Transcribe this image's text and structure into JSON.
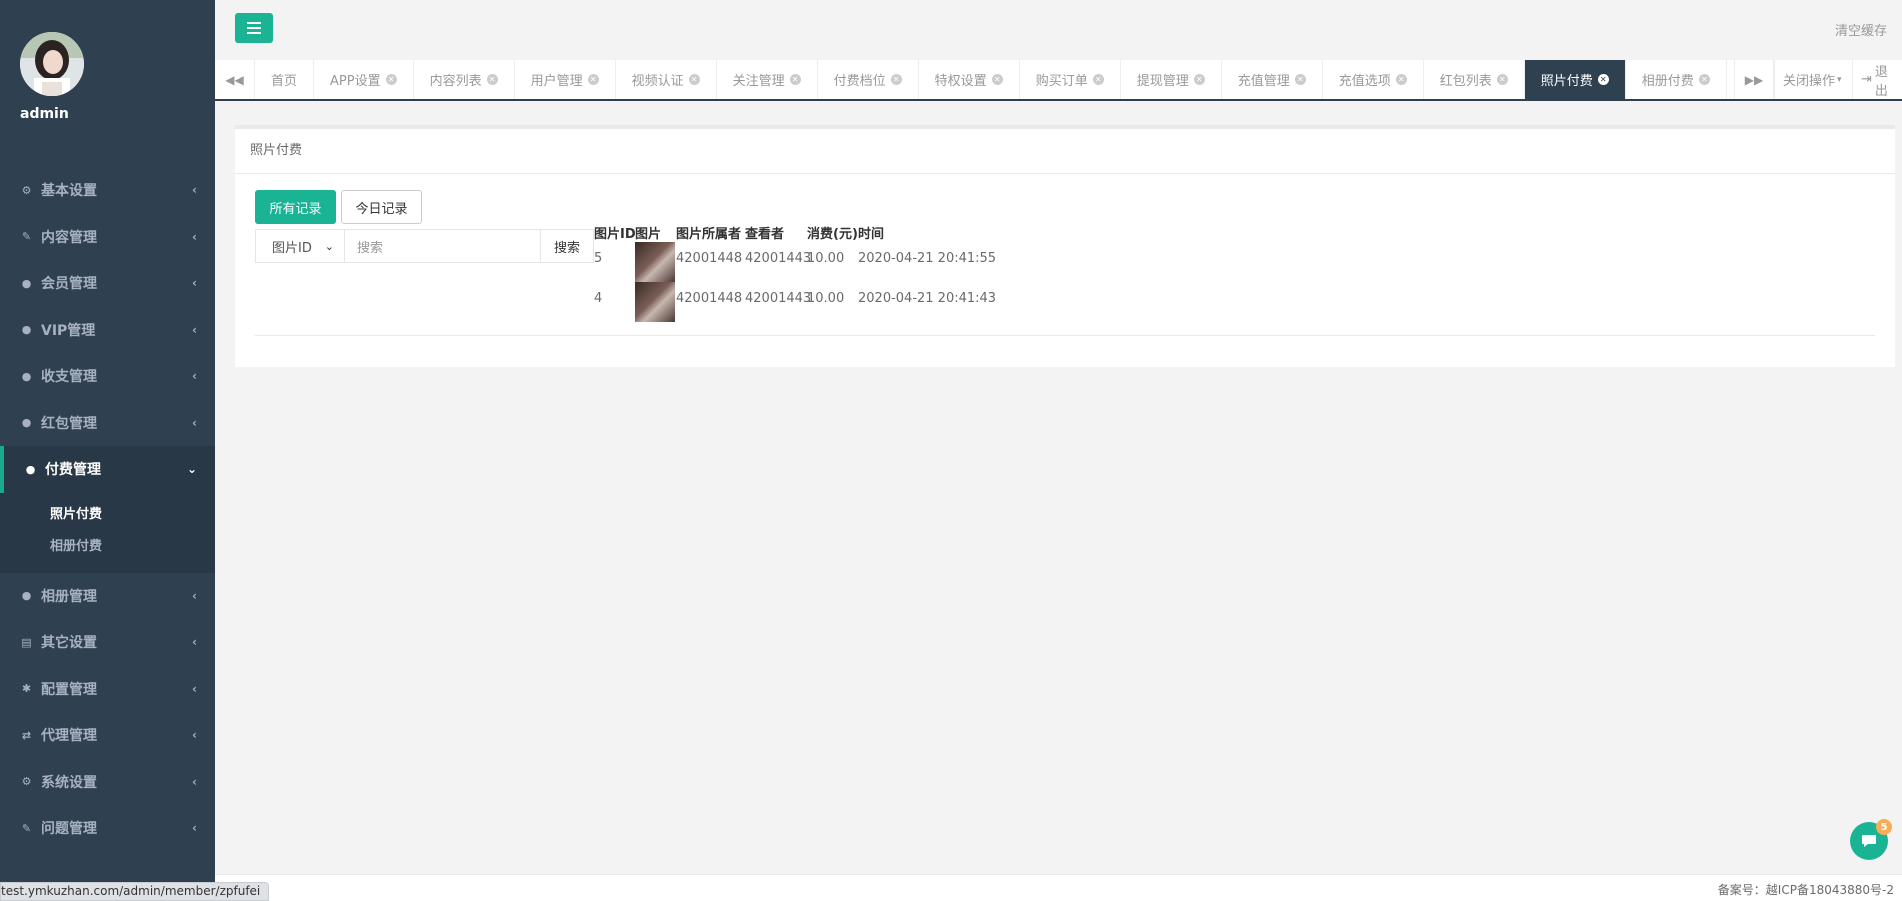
{
  "sidebar": {
    "username": "admin",
    "items": [
      {
        "label": "基本设置",
        "icon": "gear-icon"
      },
      {
        "label": "内容管理",
        "icon": "edit-icon"
      },
      {
        "label": "会员管理",
        "icon": "user-icon"
      },
      {
        "label": "VIP管理",
        "icon": "user-icon"
      },
      {
        "label": "收支管理",
        "icon": "user-icon"
      },
      {
        "label": "红包管理",
        "icon": "user-icon"
      },
      {
        "label": "付费管理",
        "icon": "user-icon"
      },
      {
        "label": "相册管理",
        "icon": "user-icon"
      },
      {
        "label": "其它设置",
        "icon": "list-icon"
      },
      {
        "label": "配置管理",
        "icon": "asterisk-icon"
      },
      {
        "label": "代理管理",
        "icon": "exchange-icon"
      },
      {
        "label": "系统设置",
        "icon": "gears-icon"
      },
      {
        "label": "问题管理",
        "icon": "edit-icon"
      }
    ],
    "submenu": [
      "照片付费",
      "相册付费"
    ]
  },
  "topbar": {
    "clear_cache": "清空缓存"
  },
  "tabs": [
    "首页",
    "APP设置",
    "内容列表",
    "用户管理",
    "视频认证",
    "关注管理",
    "付费档位",
    "特权设置",
    "购买订单",
    "提现管理",
    "充值管理",
    "充值选项",
    "红包列表",
    "照片付费",
    "相册付费"
  ],
  "tab_right": {
    "close_ops": "关闭操作",
    "logout": "退出"
  },
  "panel": {
    "title": "照片付费",
    "btn_all": "所有记录",
    "btn_today": "今日记录",
    "select_value": "图片ID",
    "search_placeholder": "搜索",
    "search_btn": "搜索",
    "headers": [
      "图片ID",
      "图片",
      "图片所属者",
      "查看者",
      "消费(元)",
      "时间"
    ],
    "rows": [
      {
        "id": "5",
        "owner": "42001448",
        "viewer": "42001443",
        "amount": "10.00",
        "time": "2020-04-21 20:41:55"
      },
      {
        "id": "4",
        "owner": "42001448",
        "viewer": "42001443",
        "amount": "10.00",
        "time": "2020-04-21 20:41:43"
      }
    ]
  },
  "footer": {
    "icp": "备案号：越ICP备18043880号-2"
  },
  "statusbar": {
    "url": "test.ymkuzhan.com/admin/member/zpfufei"
  },
  "chat": {
    "badge": "5"
  },
  "colors": {
    "sidebar": "#2f4050",
    "accent": "#1ab394",
    "badge": "#f8ac59"
  }
}
